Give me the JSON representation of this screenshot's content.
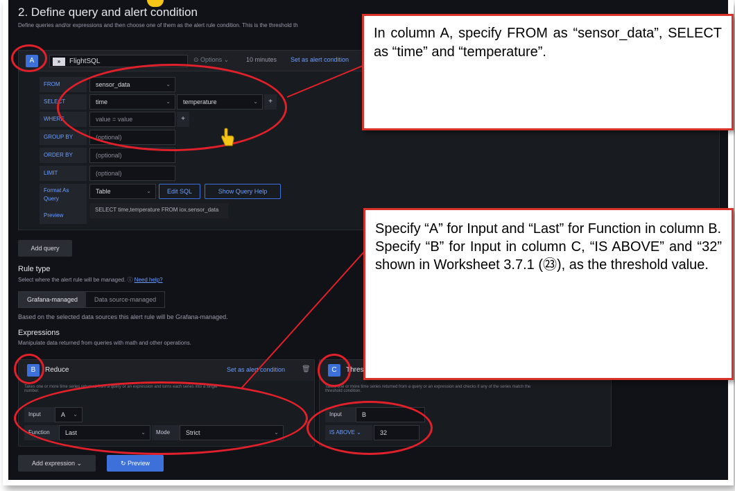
{
  "section": {
    "title": "2. Define query and alert condition",
    "description": "Define queries and/or expressions and then choose one of them as the alert rule condition. This is the threshold th"
  },
  "query": {
    "ref": "A",
    "datasource": "FlightSQL",
    "options": "Options",
    "time_range": "10 minutes",
    "set_alert": "Set as alert condition",
    "rows": {
      "from_label": "FROM",
      "from_value": "sensor_data",
      "select_label": "SELECT",
      "select_col1": "time",
      "select_col2": "temperature",
      "select_add": "+",
      "where_label": "WHERE",
      "where_value": "value = value",
      "where_add": "+",
      "groupby_label": "GROUP BY",
      "groupby_value": "(optional)",
      "orderby_label": "ORDER BY",
      "orderby_value": "(optional)",
      "limit_label": "LIMIT",
      "limit_value": "(optional)",
      "format_label": "Format As",
      "format_value": "Table",
      "edit_sql": "Edit SQL",
      "show_help": "Show Query Help",
      "preview_label_1": "Query",
      "preview_label_2": "Preview",
      "preview_sql": "SELECT time,temperature FROM iox.sensor_data"
    }
  },
  "add_query": "Add query",
  "rule_type": {
    "title": "Rule type",
    "desc": "Select where the alert rule will be managed.",
    "need_help": "Need help?",
    "tab_grafana": "Grafana-managed",
    "tab_ds": "Data source-managed",
    "note": "Based on the selected data sources this alert rule will be Grafana-managed."
  },
  "expressions": {
    "title": "Expressions",
    "desc": "Manipulate data returned from queries with math and other operations.",
    "b": {
      "ref": "B",
      "name": "Reduce",
      "set_alert": "Set as alert condition",
      "desc_1": "Takes one or more time series returned from a query or an expression and turns each series into a single",
      "desc_2": "number.",
      "input_label": "Input",
      "input_value": "A",
      "function_label": "Function",
      "function_value": "Last",
      "mode_label": "Mode",
      "mode_value": "Strict"
    },
    "c": {
      "ref": "C",
      "name": "Thres",
      "desc_1": "Takes one or more time series returned from a query or an expression and checks if any of the series match the",
      "desc_2": "threshold condition.",
      "input_label": "Input",
      "input_value": "B",
      "cond_label": "IS ABOVE",
      "cond_value": "32"
    }
  },
  "add_expression": "Add expression",
  "preview": "Preview",
  "callouts": {
    "one": "In column A, specify FROM as “sensor_data”, SELECT as “time” and “temperature”.",
    "two_a": "Specify “A” for Input and “Last” for Function in column B.",
    "two_b": "Specify “B” for Input in column C, “IS ABOVE” and “32” shown in Worksheet 3.7.1 (㉓), as the threshold value."
  },
  "colors": {
    "annotation_red": "#d9322a",
    "accent_blue": "#3d71d9",
    "link_blue": "#6e9fff",
    "background": "#111217"
  }
}
